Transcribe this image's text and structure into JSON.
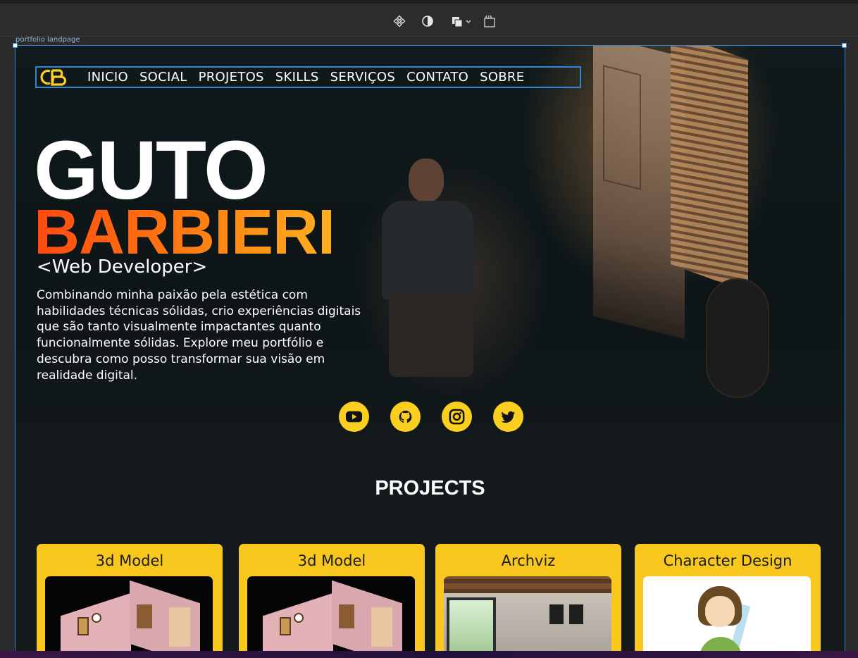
{
  "editor": {
    "frame_label": "portfolio landpage",
    "toolbar_icons": [
      "component-icon",
      "contrast-icon",
      "boolean-icon",
      "code-icon"
    ]
  },
  "nav": {
    "logo_text": "GB",
    "links": [
      "INICIO",
      "SOCIAL",
      "PROJETOS",
      "SKILLS",
      "SERVIÇOS",
      "CONTATO",
      "SOBRE"
    ]
  },
  "hero": {
    "first_name": "GUTO",
    "last_name": "BARBIERI",
    "role": "<Web Developer>",
    "description": "Combinando minha paixão pela estética com habilidades técnicas sólidas, crio experiências digitais que são tanto visualmente impactantes quanto funcionalmente sólidas. Explore meu portfólio e descubra como posso transformar sua visão em realidade digital."
  },
  "social": {
    "icons": [
      "youtube-icon",
      "github-icon",
      "instagram-icon",
      "twitter-icon"
    ]
  },
  "projects": {
    "heading": "PROJECTS",
    "cards": [
      {
        "title": "3d Model"
      },
      {
        "title": "3d Model"
      },
      {
        "title": "Archviz"
      },
      {
        "title": "Character Design"
      }
    ]
  },
  "colors": {
    "accent_yellow": "#fbcf1f",
    "title_orange_start": "#ff4a12",
    "title_orange_end": "#ffb020",
    "background": "#141a1c",
    "selection_blue": "#2f86d6"
  }
}
